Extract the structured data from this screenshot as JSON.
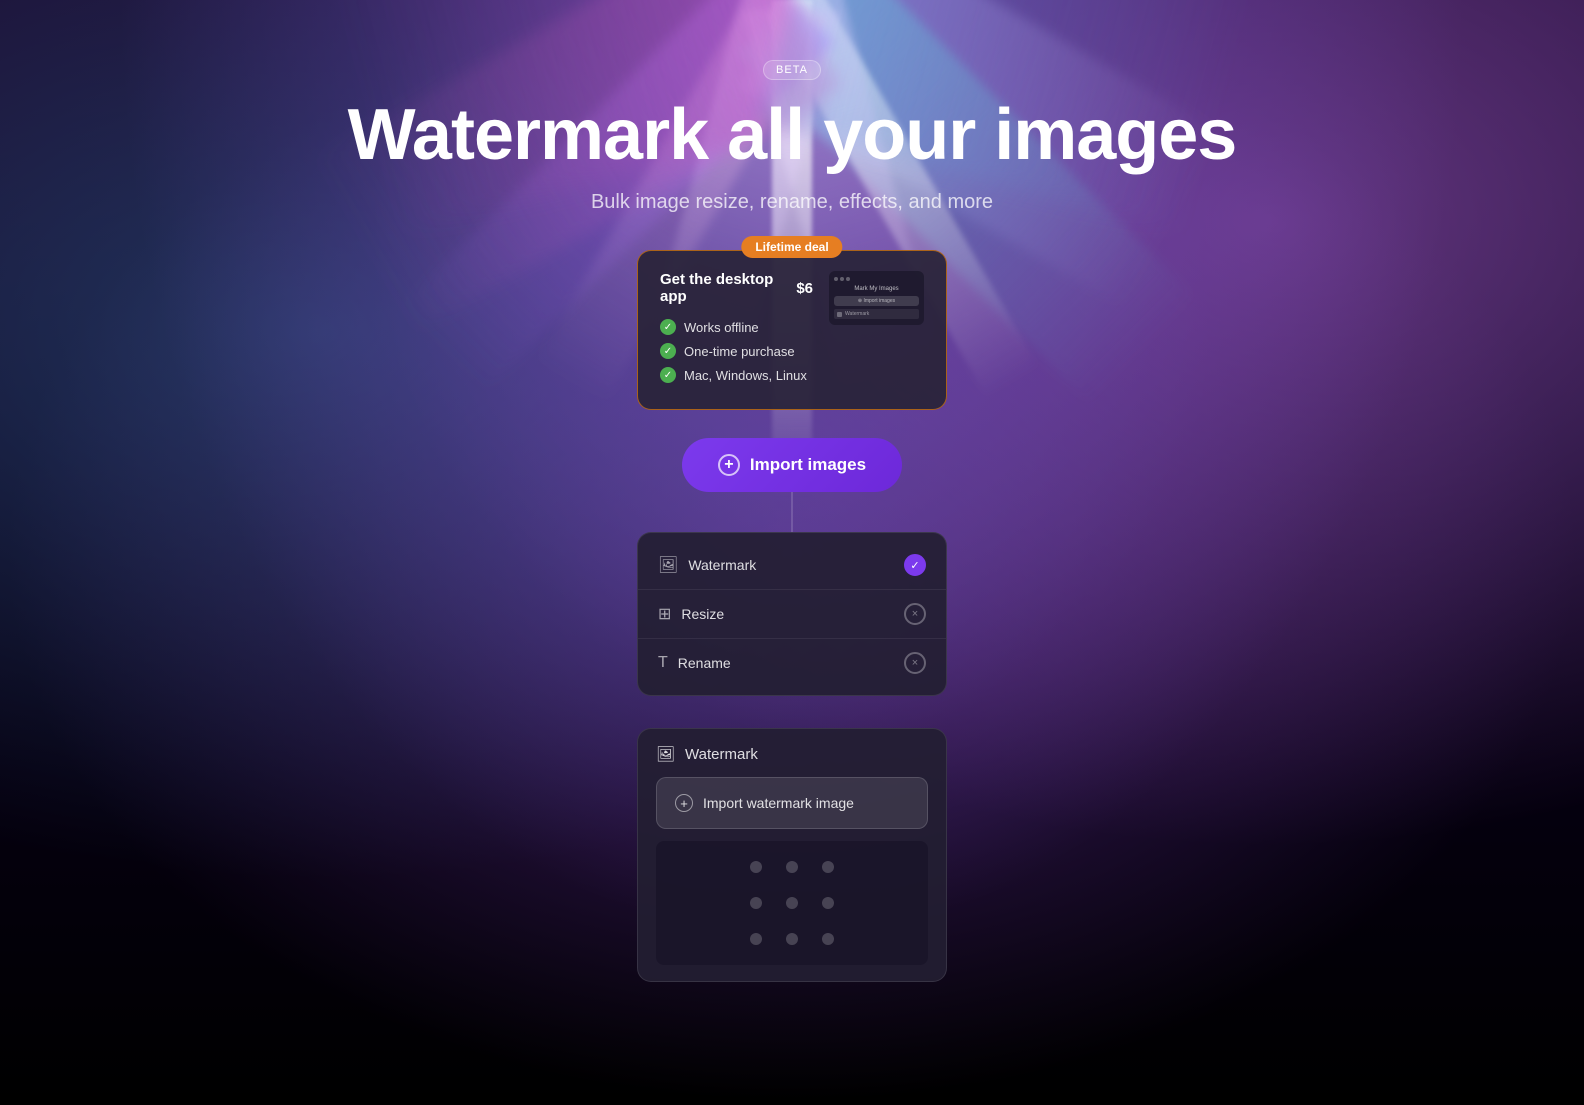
{
  "meta": {
    "beta_label": "BETA"
  },
  "hero": {
    "title": "Watermark all your images",
    "subtitle": "Bulk image resize, rename, effects, and more"
  },
  "app_card": {
    "lifetime_badge": "Lifetime deal",
    "title": "Get the desktop app",
    "price": "$6",
    "features": [
      "Works offline",
      "One-time purchase",
      "Mac, Windows, Linux"
    ],
    "preview": {
      "title": "Mark My Images",
      "button1": "⊕ Import images",
      "row1": "Watermark"
    }
  },
  "import_button": {
    "label": "Import images"
  },
  "options": {
    "items": [
      {
        "label": "Watermark",
        "state": "on"
      },
      {
        "label": "Resize",
        "state": "off"
      },
      {
        "label": "Rename",
        "state": "off"
      }
    ]
  },
  "watermark_section": {
    "title": "Watermark",
    "import_label": "Import watermark image",
    "position_label": "Position grid"
  },
  "icons": {
    "watermark": "🖼",
    "resize": "⊞",
    "rename": "T",
    "plus": "+",
    "check": "✓",
    "x": "×"
  }
}
